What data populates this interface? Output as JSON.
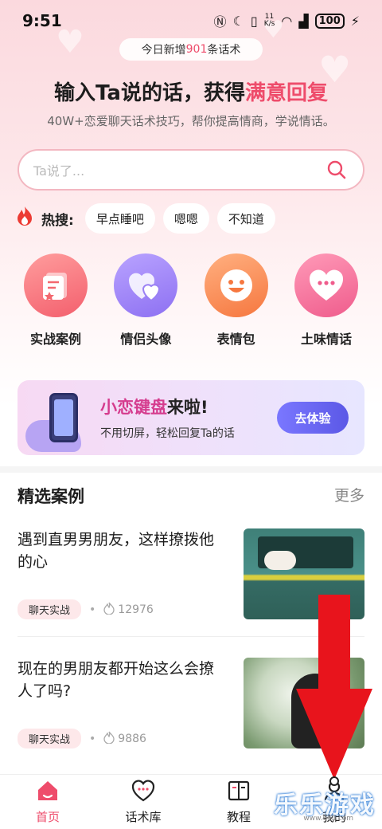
{
  "status_bar": {
    "time": "9:51",
    "net_speed_value": "11",
    "net_speed_unit": "K/s",
    "battery": "100"
  },
  "top_pill": {
    "prefix": "今日新增",
    "count": "901",
    "suffix": "条话术"
  },
  "headline": {
    "main": "输入Ta说的话，获得",
    "highlight": "满意回复",
    "subtitle": "40W+恋爱聊天话术技巧，帮你提高情商，学说情话。"
  },
  "search": {
    "placeholder": "Ta说了..."
  },
  "hot_search": {
    "label": "热搜:",
    "chips": [
      "早点睡吧",
      "嗯嗯",
      "不知道"
    ]
  },
  "features": [
    {
      "label": "实战案例",
      "icon": "cases-icon"
    },
    {
      "label": "情侣头像",
      "icon": "couple-avatar-icon"
    },
    {
      "label": "表情包",
      "icon": "emoji-icon"
    },
    {
      "label": "土味情话",
      "icon": "love-talk-icon"
    }
  ],
  "banner": {
    "title_highlight": "小恋键盘",
    "title_suffix": "来啦!",
    "subtitle": "不用切屏，轻松回复Ta的话",
    "button": "去体验"
  },
  "featured": {
    "title": "精选案例",
    "more": "更多",
    "cards": [
      {
        "title": " 遇到直男男朋友，这样撩拨他的心",
        "tag": "聊天实战",
        "likes": "12976"
      },
      {
        "title": "现在的男朋友都开始这么会撩人了吗?",
        "tag": "聊天实战",
        "likes": "9886"
      }
    ]
  },
  "tabbar": {
    "tabs": [
      "首页",
      "话术库",
      "教程",
      "我的"
    ],
    "active": 0
  },
  "watermark": {
    "text": "乐乐游戏",
    "url": "www.66ll.com"
  },
  "colors": {
    "accent": "#ee4c6b",
    "arrow": "#e8141c"
  }
}
